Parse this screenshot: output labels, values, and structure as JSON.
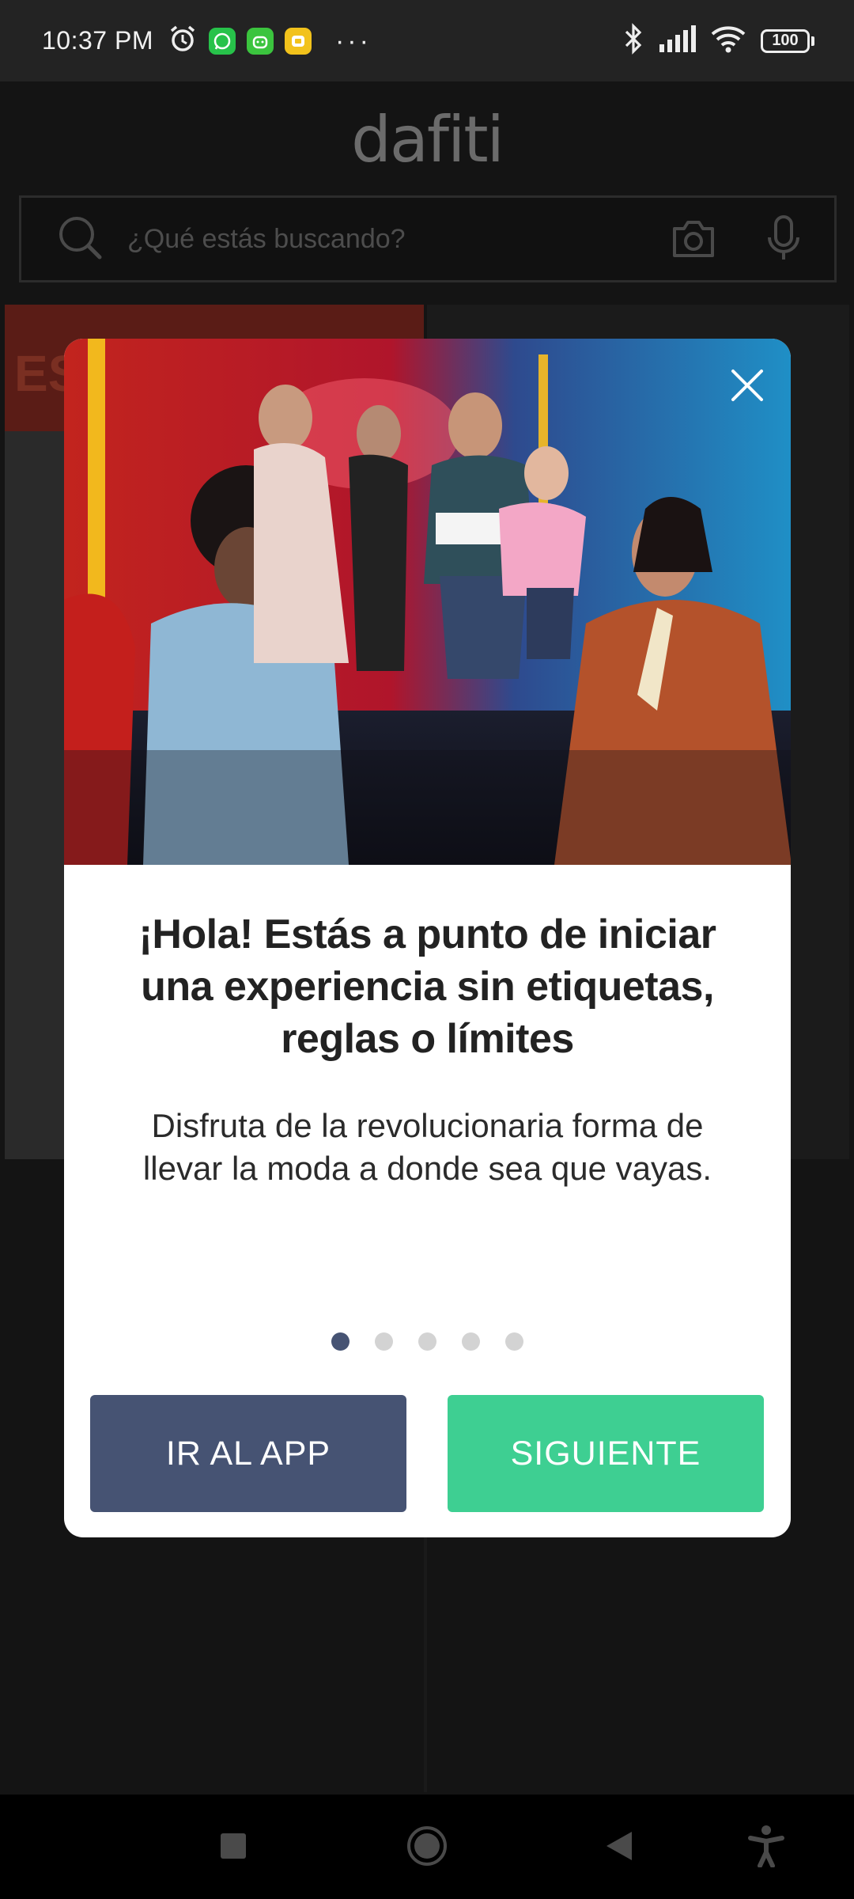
{
  "status_bar": {
    "time": "10:37 PM",
    "battery": "100",
    "overflow": "···"
  },
  "background_app": {
    "brand": "dafiti",
    "search": {
      "placeholder": "¿Qué estás buscando?"
    },
    "banner_text": "ES"
  },
  "modal": {
    "title": "¡Hola! Estás a punto de iniciar una experiencia sin etiquetas, reglas o límites",
    "subtitle": "Disfruta de la revolucionaria forma de llevar la moda a donde sea que vayas.",
    "pager": {
      "total": 5,
      "active_index": 0
    },
    "buttons": {
      "go_to_app": "IR AL APP",
      "next": "SIGUIENTE"
    }
  },
  "colors": {
    "primary_dark": "#465373",
    "accent_green": "#3ecf92",
    "overlay": "#141414"
  },
  "icons": {
    "status": [
      "alarm-icon",
      "whatsapp-icon",
      "android-icon",
      "notification-app-icon",
      "bluetooth-icon",
      "signal-icon",
      "wifi-icon",
      "battery-icon"
    ],
    "search": [
      "search-icon",
      "camera-icon",
      "microphone-icon"
    ],
    "nav": [
      "recents-square-icon",
      "home-circle-icon",
      "back-triangle-icon",
      "accessibility-icon"
    ],
    "modal": [
      "close-icon"
    ]
  }
}
